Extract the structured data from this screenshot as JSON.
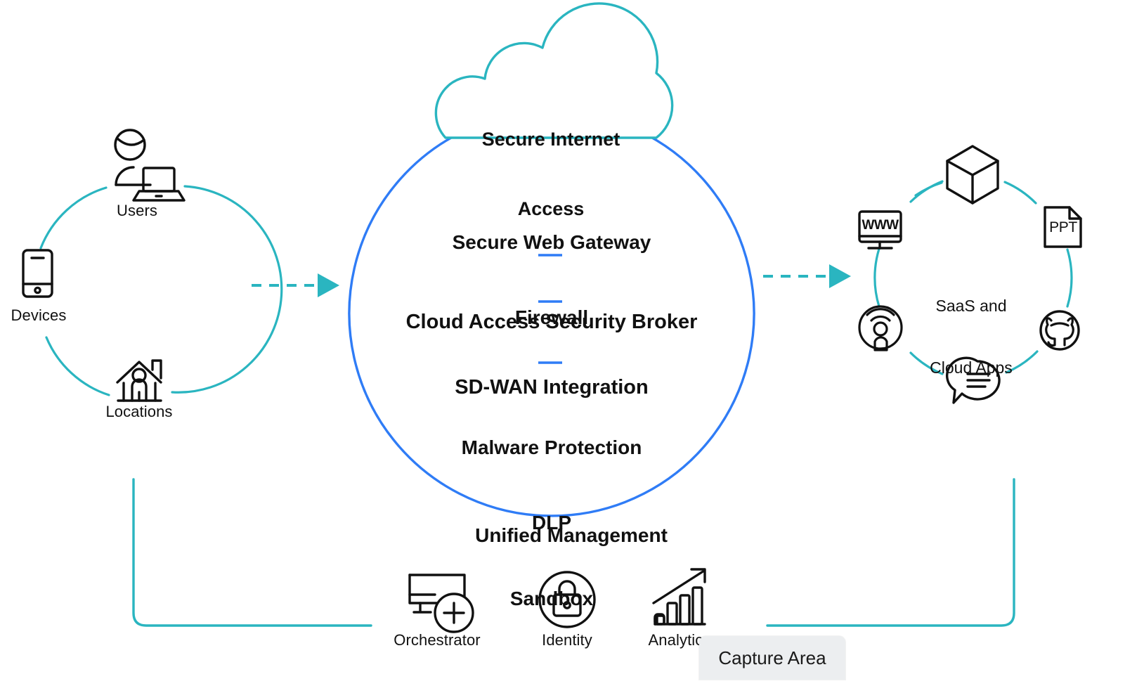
{
  "colors": {
    "teal": "#2ab5c0",
    "blue": "#2f7cf6",
    "ink": "#111111",
    "tooltip_bg": "#eceef0"
  },
  "left_group": {
    "name": "access-sources",
    "items": [
      {
        "label": "Users",
        "icon": "user-laptop-icon"
      },
      {
        "label": "Devices",
        "icon": "mobile-phone-icon"
      },
      {
        "label": "Locations",
        "icon": "home-location-icon"
      }
    ]
  },
  "cloud": {
    "title_line1": "Secure Internet",
    "title_line2": "Access",
    "icon": "cloud-icon"
  },
  "core": {
    "groups": [
      {
        "lines": [
          "Secure Web Gateway",
          "Firewall"
        ]
      },
      {
        "lines": [
          "Cloud Access Security Broker"
        ]
      },
      {
        "lines": [
          "SD-WAN Integration"
        ]
      },
      {
        "lines": [
          "Malware Protection",
          "DLP",
          "Sandbox"
        ]
      }
    ],
    "separator": "dash"
  },
  "right_group": {
    "label_line1": "SaaS and",
    "label_line2": "Cloud Apps",
    "icons": [
      {
        "name": "cube-icon",
        "position": "top"
      },
      {
        "name": "ppt-file-icon",
        "position": "top-right",
        "text": "PPT"
      },
      {
        "name": "github-icon",
        "position": "bottom-right"
      },
      {
        "name": "chat-bubble-icon",
        "position": "bottom"
      },
      {
        "name": "broadcast-podcast-icon",
        "position": "bottom-left"
      },
      {
        "name": "www-monitor-icon",
        "position": "top-left",
        "text": "WWW"
      }
    ]
  },
  "arrows": [
    {
      "name": "arrow-sources-to-core",
      "style": "dashed",
      "direction": "right"
    },
    {
      "name": "arrow-core-to-apps",
      "style": "dashed",
      "direction": "right"
    }
  ],
  "footer": {
    "title": "Unified Management",
    "items": [
      {
        "label": "Orchestrator",
        "icon": "monitor-plus-icon"
      },
      {
        "label": "Identity",
        "icon": "lock-circle-icon"
      },
      {
        "label": "Analytics",
        "icon": "bar-chart-arrow-icon"
      }
    ]
  },
  "overlay": {
    "capture_tooltip": "Capture Area"
  }
}
